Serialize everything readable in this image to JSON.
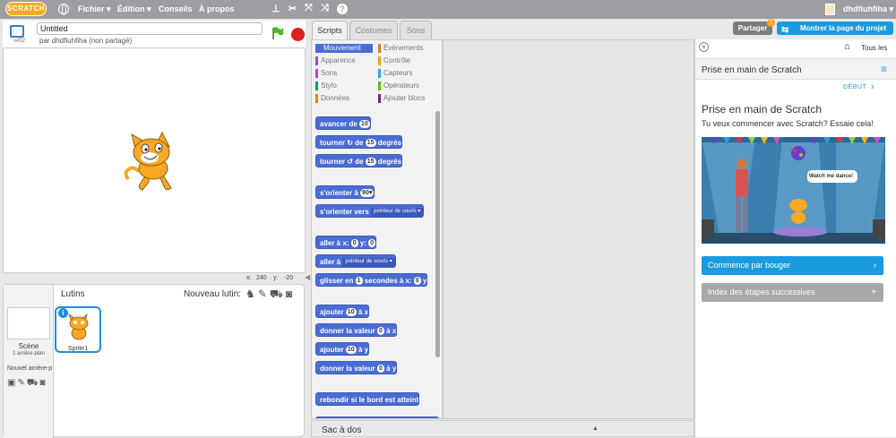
{
  "topbar": {
    "logo": "SCRATCH",
    "menus": [
      "Fichier ▾",
      "Édition ▾",
      "Conseils",
      "À propos"
    ],
    "help": "?",
    "username": "dhdfiuhfiha ▾"
  },
  "stage": {
    "version": "v452",
    "title_value": "Untitled",
    "byline": "par dhdfiuhfiha (non partagé)",
    "x_label": "x:",
    "x_value": "240",
    "y_label": "y:",
    "y_value": "-20"
  },
  "sprites": {
    "header": "Lutins",
    "new_sprite": "Nouveau lutin:",
    "scene_label": "Scène",
    "scene_sub": "1 arrière-plan",
    "new_backdrop": "Nouvel arrière-p",
    "sprite_name": "Sprite1",
    "info": "i"
  },
  "tabs": [
    "Scripts",
    "Costumes",
    "Sons"
  ],
  "categories": [
    {
      "label": "Mouvement",
      "color": "#4a6cd4",
      "selected": true
    },
    {
      "label": "Évènements",
      "color": "#c88330"
    },
    {
      "label": "Apparence",
      "color": "#8a55d7"
    },
    {
      "label": "Contrôle",
      "color": "#e1a91a"
    },
    {
      "label": "Sons",
      "color": "#bb42c3"
    },
    {
      "label": "Capteurs",
      "color": "#2ca5e2"
    },
    {
      "label": "Stylo",
      "color": "#0e9a6c"
    },
    {
      "label": "Opérateurs",
      "color": "#5cb712"
    },
    {
      "label": "Données",
      "color": "#ee7d16"
    },
    {
      "label": "Ajouter blocs",
      "color": "#632d99"
    }
  ],
  "blocks": {
    "b1": {
      "t1": "avancer de",
      "n1": "10"
    },
    "b2": {
      "t1": "tourner",
      "t2": "de",
      "n1": "15",
      "t3": "degrés"
    },
    "b3": {
      "t1": "tourner",
      "t2": "de",
      "n1": "15",
      "t3": "degrés"
    },
    "b4": {
      "t1": "s'orienter à",
      "n1": "90▾"
    },
    "b5": {
      "t1": "s'orienter vers",
      "d1": "pointeur de souris ▾"
    },
    "b6": {
      "t1": "aller à x:",
      "n1": "0",
      "t2": "y:",
      "n2": "0"
    },
    "b7": {
      "t1": "aller à",
      "d1": "pointeur de souris ▾"
    },
    "b8": {
      "t1": "glisser en",
      "n1": "1",
      "t2": "secondes à x:",
      "n2": "0",
      "t3": "y"
    },
    "b9": {
      "t1": "ajouter",
      "n1": "10",
      "t2": "à x"
    },
    "b10": {
      "t1": "donner la valeur",
      "n1": "0",
      "t2": "à x"
    },
    "b11": {
      "t1": "ajouter",
      "n1": "10",
      "t2": "à y"
    },
    "b12": {
      "t1": "donner la valeur",
      "n1": "0",
      "t2": "à y"
    },
    "b13": {
      "t1": "rebondir si le bord est atteint"
    }
  },
  "backpack": {
    "label": "Sac à dos",
    "arrow": "▲"
  },
  "share": {
    "partager": "Partager",
    "badge": "!",
    "project_page": "Montrer la page du projet"
  },
  "tips": {
    "close": "×",
    "all": "Tous les",
    "header": "Prise en main de Scratch",
    "debut": "DÉBUT",
    "title": "Prise en main de Scratch",
    "subtitle": "Tu veux commencer avec Scratch? Essaie cela!",
    "speech": "Watch me dance!",
    "btn_start": "Commence par bouger",
    "btn_index": "Index des étapes successives",
    "btn_start_icon": "›",
    "btn_index_icon": "+"
  }
}
